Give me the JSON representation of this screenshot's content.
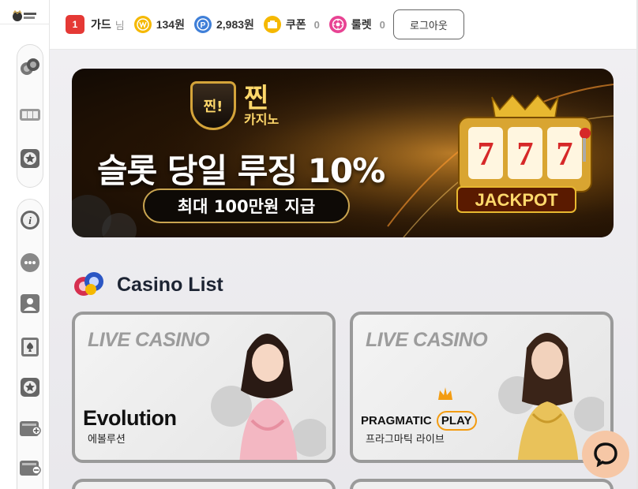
{
  "header": {
    "rank": "1",
    "username": "가드",
    "honorific": "님",
    "balance": "134원",
    "points": "2,983원",
    "coupon_label": "쿠폰",
    "coupon_count": "0",
    "roulette_label": "룰렛",
    "roulette_count": "0",
    "logout_label": "로그아웃"
  },
  "sidebar": {
    "icons": [
      "poker-chips-icon",
      "slot-machine-icon",
      "star-badge-icon",
      "info-icon",
      "chat-bubble-icon",
      "user-icon",
      "spade-card-icon",
      "star-badge-icon",
      "wallet-deposit-icon",
      "wallet-withdraw-icon"
    ]
  },
  "banner": {
    "brand_big": "찐",
    "brand_small": "카지노",
    "shield_text": "찐!",
    "headline": "슬롯 당일 루징 10%",
    "subline": "최대 100만원 지급",
    "jackpot_text": "JACKPOT",
    "slot_digits": [
      "7",
      "7",
      "7"
    ]
  },
  "section": {
    "title": "Casino List"
  },
  "cards": [
    {
      "live": "LIVE CASINO",
      "provider": "Evolution",
      "provider_kor": "에볼루션"
    },
    {
      "live": "LIVE CASINO",
      "provider_main": "PRAGMATIC",
      "provider_accent": "PLAY",
      "provider_kor": "프라그마틱 라이브"
    }
  ],
  "colors": {
    "rank_badge": "#e53935",
    "balance_coin": "#f5b800",
    "point_coin": "#3f7fd8",
    "coupon_icon": "#f5b800",
    "roulette_icon": "#e84393",
    "card_border": "#9a9a9a",
    "chat_button": "#f6c7a6"
  }
}
